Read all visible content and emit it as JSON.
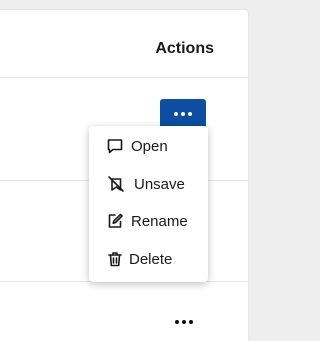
{
  "table": {
    "actions_header": "Actions"
  },
  "menu": {
    "items": [
      {
        "label": "Open",
        "icon": "comment-icon"
      },
      {
        "label": "Unsave",
        "icon": "unsave-icon"
      },
      {
        "label": "Rename",
        "icon": "edit-icon"
      },
      {
        "label": "Delete",
        "icon": "trash-icon"
      }
    ]
  },
  "colors": {
    "accent": "#0b4ea2",
    "page_background": "#eeeeee"
  }
}
